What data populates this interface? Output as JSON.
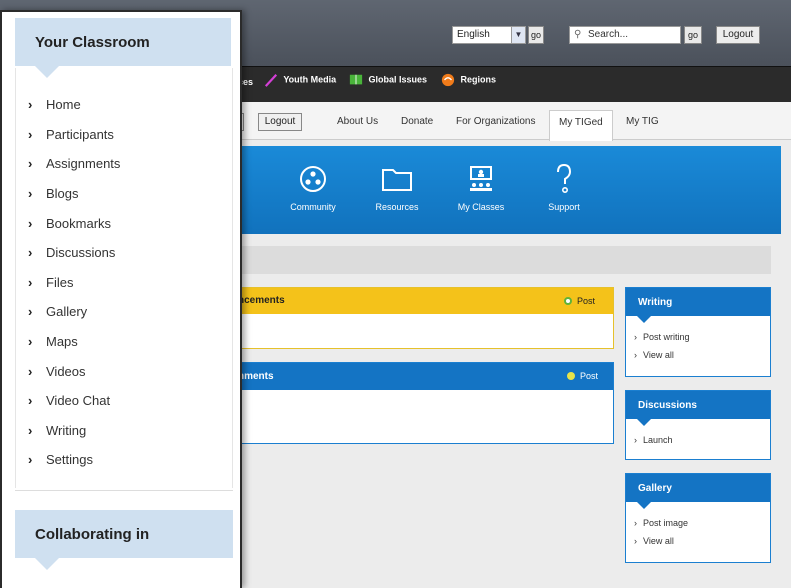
{
  "header": {
    "language": "English",
    "go_label": "go",
    "search_placeholder": "Search...",
    "logout_label": "Logout"
  },
  "channels": [
    {
      "label": "ces"
    },
    {
      "label": "Youth Media"
    },
    {
      "label": "Global Issues"
    },
    {
      "label": "Regions"
    }
  ],
  "nav": {
    "logout_label": "Logout",
    "tabs": [
      "About Us",
      "Donate",
      "For Organizations",
      "My TIGed",
      "My TIG"
    ],
    "active_tab": "My TIGed"
  },
  "icon_band": {
    "items": [
      "Community",
      "Resources",
      "My Classes",
      "Support"
    ]
  },
  "announcements": {
    "title": "ncements",
    "post_label": "Post"
  },
  "assignments": {
    "title": "nments",
    "post_label": "Post"
  },
  "widgets": {
    "writing": {
      "title": "Writing",
      "links": [
        "Post writing",
        "View all"
      ]
    },
    "discussions": {
      "title": "Discussions",
      "links": [
        "Launch"
      ]
    },
    "gallery": {
      "title": "Gallery",
      "links": [
        "Post image",
        "View all"
      ]
    }
  },
  "sidebar": {
    "title": "Your Classroom",
    "items": [
      "Home",
      "Participants",
      "Assignments",
      "Blogs",
      "Bookmarks",
      "Discussions",
      "Files",
      "Gallery",
      "Maps",
      "Videos",
      "Video Chat",
      "Writing",
      "Settings"
    ],
    "collab_title": "Collaborating in"
  },
  "colors": {
    "header_bg": "#4b515b",
    "channel_bg": "#2b2b2b",
    "band_blue": "#1474c4",
    "announce_yellow": "#f4c21a",
    "sidebar_head": "#cfe0f0"
  }
}
